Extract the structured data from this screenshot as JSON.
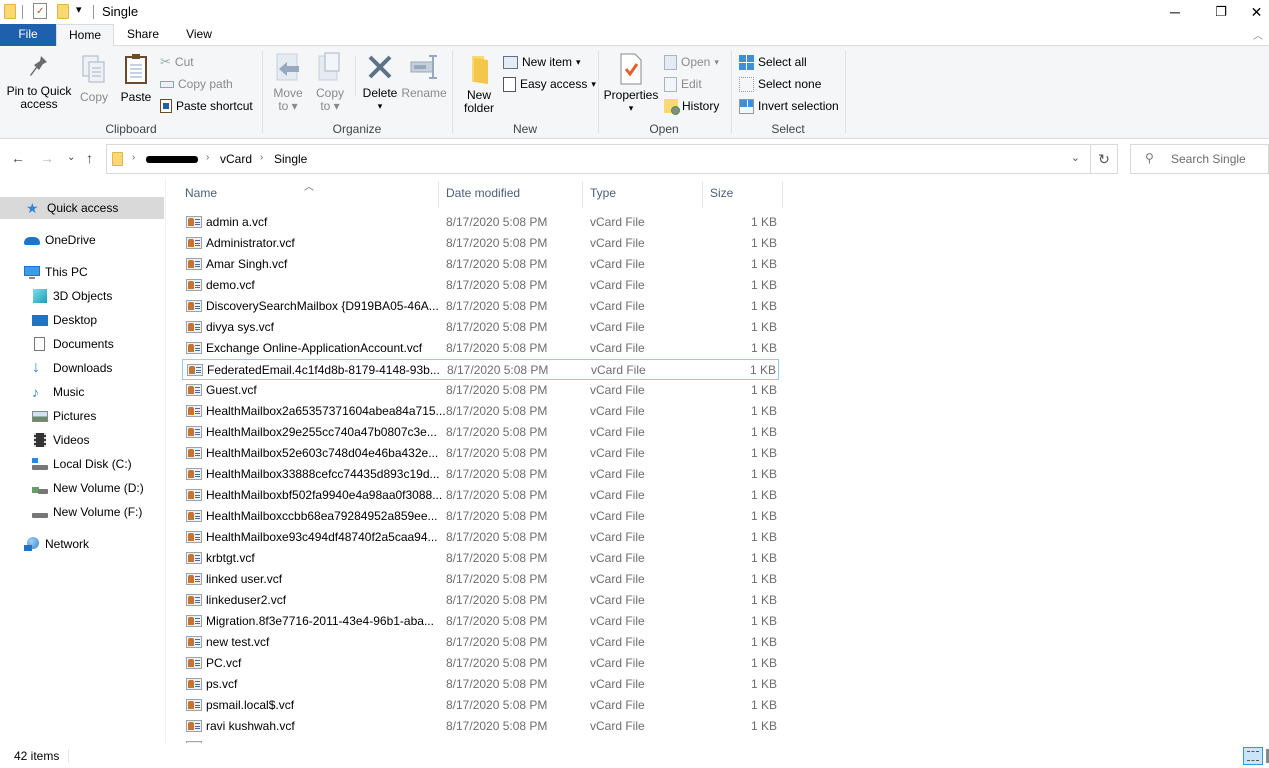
{
  "window": {
    "title": "Single",
    "controls": {
      "minimize": "─",
      "restore": "❐",
      "close": "✕"
    }
  },
  "tabs": [
    {
      "label": "File",
      "active": false
    },
    {
      "label": "Home",
      "active": true
    },
    {
      "label": "Share",
      "active": false
    },
    {
      "label": "View",
      "active": false
    }
  ],
  "ribbon": {
    "clipboard": {
      "label": "Clipboard",
      "pin": "Pin to Quick access",
      "pin_line1": "Pin to Quick",
      "pin_line2": "access",
      "copy": "Copy",
      "paste": "Paste",
      "cut": "Cut",
      "copy_path": "Copy path",
      "paste_shortcut": "Paste shortcut"
    },
    "organize": {
      "label": "Organize",
      "move_to_1": "Move",
      "move_to_2": "to",
      "copy_to_1": "Copy",
      "copy_to_2": "to",
      "delete": "Delete",
      "rename": "Rename"
    },
    "new": {
      "label": "New",
      "new_folder_1": "New",
      "new_folder_2": "folder",
      "new_item": "New item",
      "easy_access": "Easy access"
    },
    "open": {
      "label": "Open",
      "properties": "Properties",
      "open": "Open",
      "edit": "Edit",
      "history": "History"
    },
    "select": {
      "label": "Select",
      "select_all": "Select all",
      "select_none": "Select none",
      "invert_selection": "Invert selection"
    }
  },
  "address": {
    "crumbs": [
      "[redacted]",
      "vCard",
      "Single"
    ],
    "search_placeholder": "Search Single"
  },
  "navpane": {
    "items": [
      {
        "label": "Quick access",
        "icon": "star-icon",
        "selected": true
      },
      {
        "label": "OneDrive",
        "icon": "cloud-icon"
      },
      {
        "label": "This PC",
        "icon": "computer-icon"
      },
      {
        "label": "3D Objects",
        "icon": "cube-icon"
      },
      {
        "label": "Desktop",
        "icon": "desktop-icon"
      },
      {
        "label": "Documents",
        "icon": "document-icon"
      },
      {
        "label": "Downloads",
        "icon": "download-icon"
      },
      {
        "label": "Music",
        "icon": "music-icon"
      },
      {
        "label": "Pictures",
        "icon": "pictures-icon"
      },
      {
        "label": "Videos",
        "icon": "videos-icon"
      },
      {
        "label": "Local Disk (C:)",
        "icon": "drive-icon"
      },
      {
        "label": "New Volume (D:)",
        "icon": "drive-icon"
      },
      {
        "label": "New Volume (F:)",
        "icon": "drive-icon"
      },
      {
        "label": "Network",
        "icon": "network-icon"
      }
    ]
  },
  "filelist": {
    "columns": {
      "name": "Name",
      "date": "Date modified",
      "type": "Type",
      "size": "Size"
    },
    "rows": [
      {
        "name": "admin a.vcf",
        "date": "8/17/2020 5:08 PM",
        "type": "vCard File",
        "size": "1 KB"
      },
      {
        "name": "Administrator.vcf",
        "date": "8/17/2020 5:08 PM",
        "type": "vCard File",
        "size": "1 KB"
      },
      {
        "name": "Amar Singh.vcf",
        "date": "8/17/2020 5:08 PM",
        "type": "vCard File",
        "size": "1 KB"
      },
      {
        "name": "demo.vcf",
        "date": "8/17/2020 5:08 PM",
        "type": "vCard File",
        "size": "1 KB"
      },
      {
        "name": "DiscoverySearchMailbox {D919BA05-46A...",
        "date": "8/17/2020 5:08 PM",
        "type": "vCard File",
        "size": "1 KB"
      },
      {
        "name": "divya sys.vcf",
        "date": "8/17/2020 5:08 PM",
        "type": "vCard File",
        "size": "1 KB"
      },
      {
        "name": "Exchange Online-ApplicationAccount.vcf",
        "date": "8/17/2020 5:08 PM",
        "type": "vCard File",
        "size": "1 KB"
      },
      {
        "name": "FederatedEmail.4c1f4d8b-8179-4148-93b...",
        "date": "8/17/2020 5:08 PM",
        "type": "vCard File",
        "size": "1 KB",
        "focused": true
      },
      {
        "name": "Guest.vcf",
        "date": "8/17/2020 5:08 PM",
        "type": "vCard File",
        "size": "1 KB"
      },
      {
        "name": "HealthMailbox2a65357371604abea84a715...",
        "date": "8/17/2020 5:08 PM",
        "type": "vCard File",
        "size": "1 KB"
      },
      {
        "name": "HealthMailbox29e255cc740a47b0807c3e...",
        "date": "8/17/2020 5:08 PM",
        "type": "vCard File",
        "size": "1 KB"
      },
      {
        "name": "HealthMailbox52e603c748d04e46ba432e...",
        "date": "8/17/2020 5:08 PM",
        "type": "vCard File",
        "size": "1 KB"
      },
      {
        "name": "HealthMailbox33888cefcc74435d893c19d...",
        "date": "8/17/2020 5:08 PM",
        "type": "vCard File",
        "size": "1 KB"
      },
      {
        "name": "HealthMailboxbf502fa9940e4a98aa0f3088...",
        "date": "8/17/2020 5:08 PM",
        "type": "vCard File",
        "size": "1 KB"
      },
      {
        "name": "HealthMailboxccbb68ea79284952a859ee...",
        "date": "8/17/2020 5:08 PM",
        "type": "vCard File",
        "size": "1 KB"
      },
      {
        "name": "HealthMailboxe93c494df48740f2a5caa94...",
        "date": "8/17/2020 5:08 PM",
        "type": "vCard File",
        "size": "1 KB"
      },
      {
        "name": "krbtgt.vcf",
        "date": "8/17/2020 5:08 PM",
        "type": "vCard File",
        "size": "1 KB"
      },
      {
        "name": "linked user.vcf",
        "date": "8/17/2020 5:08 PM",
        "type": "vCard File",
        "size": "1 KB"
      },
      {
        "name": "linkeduser2.vcf",
        "date": "8/17/2020 5:08 PM",
        "type": "vCard File",
        "size": "1 KB"
      },
      {
        "name": "Migration.8f3e7716-2011-43e4-96b1-aba...",
        "date": "8/17/2020 5:08 PM",
        "type": "vCard File",
        "size": "1 KB"
      },
      {
        "name": "new test.vcf",
        "date": "8/17/2020 5:08 PM",
        "type": "vCard File",
        "size": "1 KB"
      },
      {
        "name": "PC.vcf",
        "date": "8/17/2020 5:08 PM",
        "type": "vCard File",
        "size": "1 KB"
      },
      {
        "name": "ps.vcf",
        "date": "8/17/2020 5:08 PM",
        "type": "vCard File",
        "size": "1 KB"
      },
      {
        "name": "psmail.local$.vcf",
        "date": "8/17/2020 5:08 PM",
        "type": "vCard File",
        "size": "1 KB"
      },
      {
        "name": "ravi kushwah.vcf",
        "date": "8/17/2020 5:08 PM",
        "type": "vCard File",
        "size": "1 KB"
      },
      {
        "name": "",
        "date": "",
        "type": "",
        "size": "",
        "partial": true
      }
    ]
  },
  "status": {
    "item_count": "42 items"
  },
  "colors": {
    "file_tab": "#1e5fae",
    "selection": "#d9d9d9",
    "focus_border": "#99c9ef"
  }
}
